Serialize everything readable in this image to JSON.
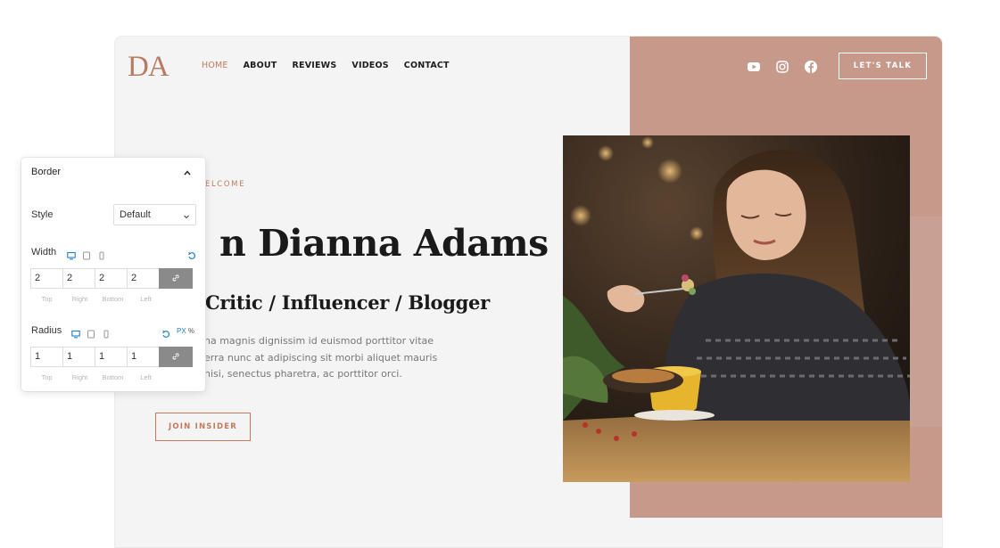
{
  "site": {
    "logo": "DA",
    "nav": [
      {
        "label": "HOME",
        "active": true
      },
      {
        "label": "ABOUT",
        "active": false
      },
      {
        "label": "REVIEWS",
        "active": false
      },
      {
        "label": "VIDEOS",
        "active": false
      },
      {
        "label": "CONTACT",
        "active": false
      }
    ],
    "social_icons": [
      "youtube-icon",
      "instagram-icon",
      "facebook-icon"
    ],
    "cta_label": "LET'S TALK",
    "welcome": "ELCOME",
    "headline": "n Dianna Adams",
    "subheadline": "Critic / Influencer / Blogger",
    "paragraph_lines": [
      "na magnis dignissim id euismod porttitor vitae",
      "erra nunc at adipiscing sit morbi aliquet mauris",
      "nisi, senectus pharetra, ac porttitor orci."
    ],
    "join_label": "JOIN INSIDER",
    "colors": {
      "accent": "#c07a5f",
      "rose": "#c6998b",
      "background": "#f4f4f4"
    }
  },
  "panel": {
    "title": "Border",
    "style_label": "Style",
    "style_value": "Default",
    "width_label": "Width",
    "width_values": [
      "2",
      "2",
      "2",
      "2"
    ],
    "radius_label": "Radius",
    "radius_values": [
      "1",
      "1",
      "1",
      "1"
    ],
    "side_labels": [
      "Top",
      "Right",
      "Bottom",
      "Left"
    ],
    "unit_px": "PX",
    "unit_pct": "%"
  }
}
